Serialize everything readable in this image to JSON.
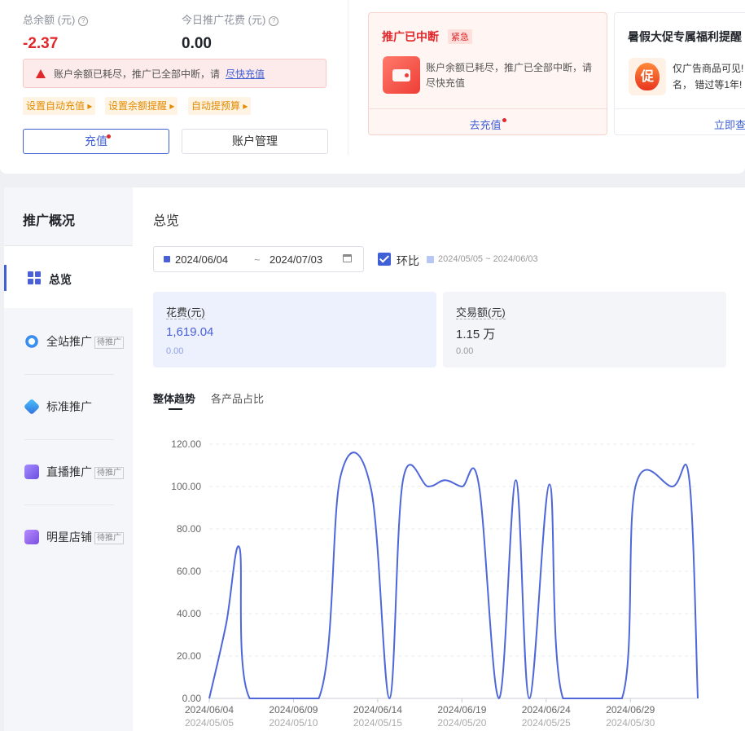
{
  "balance": {
    "label": "总余额 (元)",
    "value": "-2.37"
  },
  "spend_today": {
    "label": "今日推广花费 (元)",
    "value": "0.00"
  },
  "alert": {
    "text": "账户余额已耗尽，推广已全部中断，请",
    "link": "尽快充值"
  },
  "quick_tags": [
    "设置自动充值",
    "设置余额提醒",
    "自动提预算"
  ],
  "buttons": {
    "recharge": "充值",
    "account": "账户管理"
  },
  "notice1": {
    "title": "推广已中断",
    "badge": "紧急",
    "body": "账户余额已耗尽，推广已全部中断，请尽快充值",
    "action": "去充值"
  },
  "notice2": {
    "title": "暑假大促专属福利提醒",
    "body_line1": "仅广告商品可见!",
    "body_line2": "名， 错过等1年!",
    "icon_char": "促",
    "action": "立即查"
  },
  "sidebar": {
    "heading": "推广概况",
    "items": [
      {
        "label": "总览",
        "tag": "",
        "icon": "grid-icon"
      },
      {
        "label": "全站推广",
        "tag": "待推广",
        "icon": "target-icon"
      },
      {
        "label": "标准推广",
        "tag": "",
        "icon": "diamond-icon"
      },
      {
        "label": "直播推广",
        "tag": "待推广",
        "icon": "tv-icon"
      },
      {
        "label": "明星店铺",
        "tag": "待推广",
        "icon": "shop-icon"
      }
    ]
  },
  "main": {
    "title": "总览",
    "date_start": "2024/06/04",
    "date_sep": "~",
    "date_end": "2024/07/03",
    "compare_label": "环比",
    "compare_range": "2024/05/05 ~ 2024/06/03",
    "metrics": [
      {
        "label": "花费(元)",
        "value": "1,619.04",
        "sub": "0.00"
      },
      {
        "label": "交易额(元)",
        "value": "1.15 万",
        "sub": "0.00"
      }
    ],
    "tabs": [
      "整体趋势",
      "各产品占比"
    ]
  },
  "colors": {
    "accent": "#4a60d9",
    "danger": "#e0272b",
    "line": "#4f67d8"
  },
  "chart_data": {
    "type": "line",
    "ylim": [
      0,
      120
    ],
    "yticks": [
      "0.00",
      "20.00",
      "40.00",
      "60.00",
      "80.00",
      "100.00",
      "120.00"
    ],
    "x_labels": [
      "2024/06/04",
      "2024/06/09",
      "2024/06/14",
      "2024/06/19",
      "2024/06/24",
      "2024/06/29"
    ],
    "x_labels_prev": [
      "2024/05/05",
      "2024/05/10",
      "2024/05/15",
      "2024/05/20",
      "2024/05/25",
      "2024/05/30"
    ],
    "series": [
      {
        "values": [
          0,
          35,
          71,
          0,
          0,
          0,
          0,
          0,
          0,
          0,
          0,
          0,
          0,
          0,
          0,
          0,
          0,
          0,
          0,
          0,
          0,
          0,
          0,
          0,
          0,
          0,
          0,
          0,
          0,
          0,
          0,
          0,
          0,
          0,
          0,
          0,
          0,
          0,
          0,
          0,
          0,
          0,
          0,
          0,
          0,
          0,
          0,
          0,
          0,
          0,
          0,
          0,
          0,
          0,
          0,
          0,
          0,
          0,
          0,
          0,
          0,
          0,
          0,
          0,
          0,
          0,
          0,
          0,
          0,
          0,
          0,
          0,
          0,
          0,
          0,
          0,
          0,
          0,
          0,
          0,
          0,
          0,
          0,
          0,
          0,
          0,
          0,
          0,
          0,
          0,
          0,
          0,
          0,
          0,
          0,
          0,
          0,
          0,
          0,
          0
        ]
      }
    ],
    "points": [
      [
        0,
        0
      ],
      [
        1,
        35
      ],
      [
        1.8,
        71
      ],
      [
        2.4,
        0
      ],
      [
        6.5,
        0
      ],
      [
        7.8,
        105
      ],
      [
        9.6,
        99
      ],
      [
        10.7,
        0
      ],
      [
        11.5,
        103
      ],
      [
        13,
        100
      ],
      [
        14,
        103
      ],
      [
        15,
        100
      ],
      [
        16,
        101
      ],
      [
        17.2,
        0
      ],
      [
        18.2,
        103
      ],
      [
        19,
        0
      ],
      [
        20.2,
        101
      ],
      [
        21,
        0
      ],
      [
        24.5,
        0
      ],
      [
        25.3,
        100
      ],
      [
        27.5,
        100
      ],
      [
        28.5,
        103
      ],
      [
        29,
        0
      ]
    ]
  }
}
